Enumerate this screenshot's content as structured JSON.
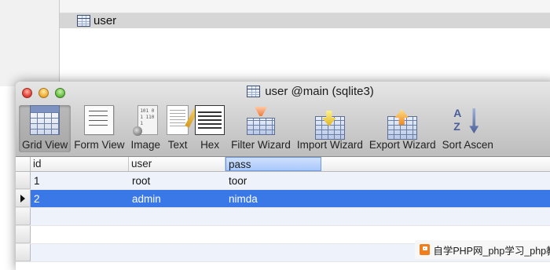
{
  "background": {
    "selected_table": "user"
  },
  "window": {
    "title": "user @main (sqlite3)",
    "toolbar": [
      {
        "label": "Grid View",
        "icon": "grid-view-icon",
        "active": true
      },
      {
        "label": "Form View",
        "icon": "form-view-icon"
      },
      {
        "label": "Image",
        "icon": "image-icon"
      },
      {
        "label": "Text",
        "icon": "text-icon"
      },
      {
        "label": "Hex",
        "icon": "hex-icon"
      },
      {
        "label": "Filter Wizard",
        "icon": "filter-wizard-icon"
      },
      {
        "label": "Import Wizard",
        "icon": "import-wizard-icon"
      },
      {
        "label": "Export Wizard",
        "icon": "export-wizard-icon"
      },
      {
        "label": "Sort Ascen",
        "icon": "sort-ascending-icon"
      }
    ]
  },
  "grid": {
    "columns": [
      "id",
      "user",
      "pass"
    ],
    "selected_column": "pass",
    "rows": [
      {
        "id": "1",
        "user": "root",
        "pass": "toor"
      },
      {
        "id": "2",
        "user": "admin",
        "pass": "nimda"
      }
    ],
    "selected_row_index": 1
  },
  "watermark": {
    "text": "自学PHP网_php学习_php教"
  },
  "colors": {
    "selection_blue": "#3b78e7",
    "column_highlight": "#a9c8fb",
    "alt_row": "#eef2fb"
  }
}
